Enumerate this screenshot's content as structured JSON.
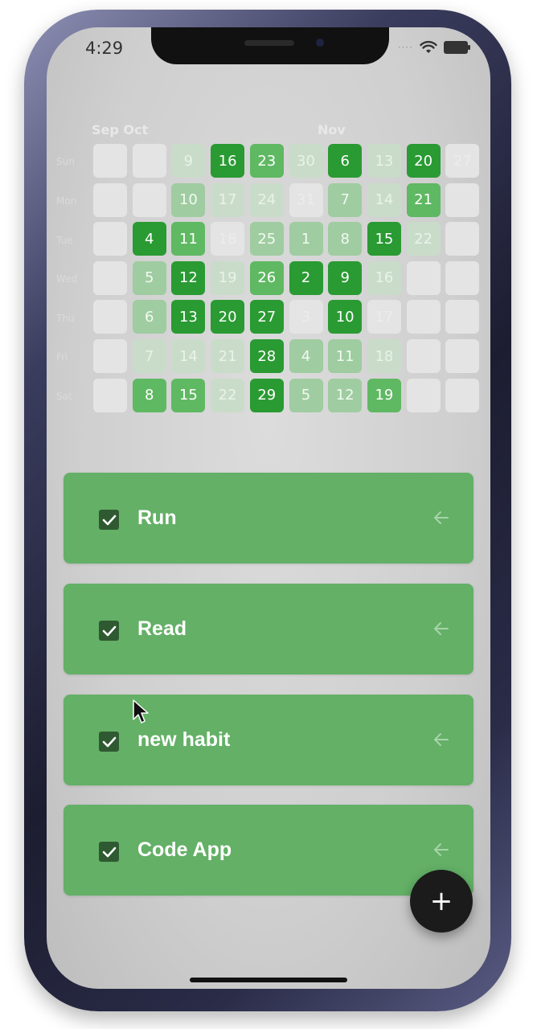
{
  "status_bar": {
    "time": "4:29"
  },
  "calendar": {
    "months": [
      "Sep Oct",
      "Nov"
    ],
    "day_labels": [
      "Sun",
      "Mon",
      "Tue",
      "Wed",
      "Thu",
      "Fri",
      "Sat"
    ],
    "columns": [
      [
        "",
        "",
        "",
        "",
        "",
        "",
        ""
      ],
      [
        "",
        "",
        "4",
        "5",
        "6",
        "7",
        "8"
      ],
      [
        "9",
        "10",
        "11",
        "12",
        "13",
        "14",
        "15"
      ],
      [
        "16",
        "17",
        "18",
        "19",
        "20",
        "21",
        "22"
      ],
      [
        "23",
        "24",
        "25",
        "26",
        "27",
        "28",
        "29"
      ],
      [
        "30",
        "31",
        "1",
        "2",
        "3",
        "4",
        "5"
      ],
      [
        "6",
        "7",
        "8",
        "9",
        "10",
        "11",
        "12"
      ],
      [
        "13",
        "14",
        "15",
        "16",
        "17",
        "18",
        "19"
      ],
      [
        "20",
        "21",
        "22",
        "",
        "",
        "",
        ""
      ],
      [
        "27",
        "",
        "",
        "",
        "",
        "",
        ""
      ]
    ],
    "levels": [
      [
        0,
        0,
        0,
        0,
        0,
        0,
        0
      ],
      [
        0,
        0,
        4,
        2,
        2,
        1,
        3
      ],
      [
        1,
        2,
        3,
        4,
        4,
        1,
        3
      ],
      [
        4,
        1,
        0,
        1,
        4,
        1,
        1
      ],
      [
        3,
        1,
        2,
        3,
        4,
        4,
        4
      ],
      [
        1,
        0,
        2,
        4,
        0,
        2,
        2
      ],
      [
        4,
        2,
        2,
        4,
        4,
        2,
        2
      ],
      [
        1,
        1,
        4,
        1,
        0,
        1,
        3
      ],
      [
        4,
        3,
        1,
        0,
        0,
        0,
        0
      ],
      [
        0,
        0,
        0,
        0,
        0,
        0,
        0
      ]
    ]
  },
  "habits": [
    {
      "label": "Run",
      "checked": true
    },
    {
      "label": "Read",
      "checked": true
    },
    {
      "label": "new habit",
      "checked": true
    },
    {
      "label": "Code App",
      "checked": true
    }
  ],
  "fab": {
    "label": "+"
  },
  "icons": {
    "wifi": "wifi-icon",
    "battery": "battery-icon",
    "check": "check-icon",
    "arrow": "arrow-left-icon",
    "cursor": "mouse-cursor-icon"
  },
  "colors": {
    "habit_card": "#63b066",
    "level0": "#e4e4e4",
    "level1": "#c9dcc9",
    "level2": "#9fcca0",
    "level3": "#5fb862",
    "level4": "#2a9a33",
    "fab": "#1b1b1b"
  }
}
